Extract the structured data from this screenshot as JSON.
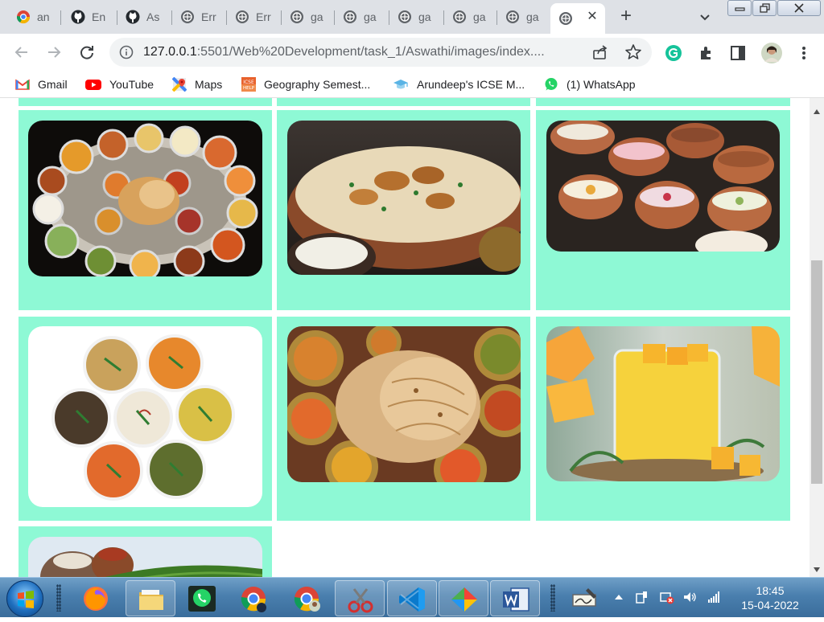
{
  "browser": {
    "tabs": [
      {
        "title": "an",
        "icon": "chrome-icon"
      },
      {
        "title": "En",
        "icon": "github-icon"
      },
      {
        "title": "As",
        "icon": "github-icon"
      },
      {
        "title": "Err",
        "icon": "globe-icon"
      },
      {
        "title": "Err",
        "icon": "globe-icon"
      },
      {
        "title": "ga",
        "icon": "globe-icon"
      },
      {
        "title": "ga",
        "icon": "globe-icon"
      },
      {
        "title": "ga",
        "icon": "globe-icon"
      },
      {
        "title": "ga",
        "icon": "globe-icon"
      },
      {
        "title": "ga",
        "icon": "globe-icon"
      },
      {
        "title": "",
        "icon": "globe-icon",
        "active": true
      }
    ],
    "new_tab_label": "+",
    "close_label": "✕",
    "address": {
      "host": "127.0.0.1",
      "rest": ":5501/Web%20Development/task_1/Aswathi/images/index...."
    },
    "bookmarks": [
      {
        "label": "Gmail",
        "icon": "gmail-icon"
      },
      {
        "label": "YouTube",
        "icon": "youtube-icon"
      },
      {
        "label": "Maps",
        "icon": "maps-icon"
      },
      {
        "label": "Geography Semest...",
        "icon": "icse-help-icon"
      },
      {
        "label": "Arundeep's ICSE M...",
        "icon": "graduation-cap-icon"
      },
      {
        "label": "(1) WhatsApp",
        "icon": "whatsapp-icon"
      }
    ],
    "accent": "#8ef9d5"
  },
  "gallery": {
    "items": [
      {
        "name": "thali-platter",
        "icon": "food-photo-icon"
      },
      {
        "name": "biryani-bowl",
        "icon": "food-photo-icon"
      },
      {
        "name": "kulhad-desserts",
        "icon": "food-photo-icon"
      },
      {
        "name": "curry-bowls",
        "icon": "food-photo-icon"
      },
      {
        "name": "paratha-curries",
        "icon": "food-photo-icon"
      },
      {
        "name": "mango-lassi",
        "icon": "food-photo-icon"
      },
      {
        "name": "banana-leaf-meal",
        "icon": "food-photo-icon"
      }
    ]
  },
  "taskbar": {
    "apps": [
      "firefox-icon",
      "file-explorer-icon",
      "whatsapp-icon",
      "chrome-icon",
      "chrome-profile-icon",
      "snipping-tool-icon",
      "vscode-icon",
      "app-icon",
      "word-icon"
    ],
    "time": "18:45",
    "date": "15-04-2022"
  }
}
